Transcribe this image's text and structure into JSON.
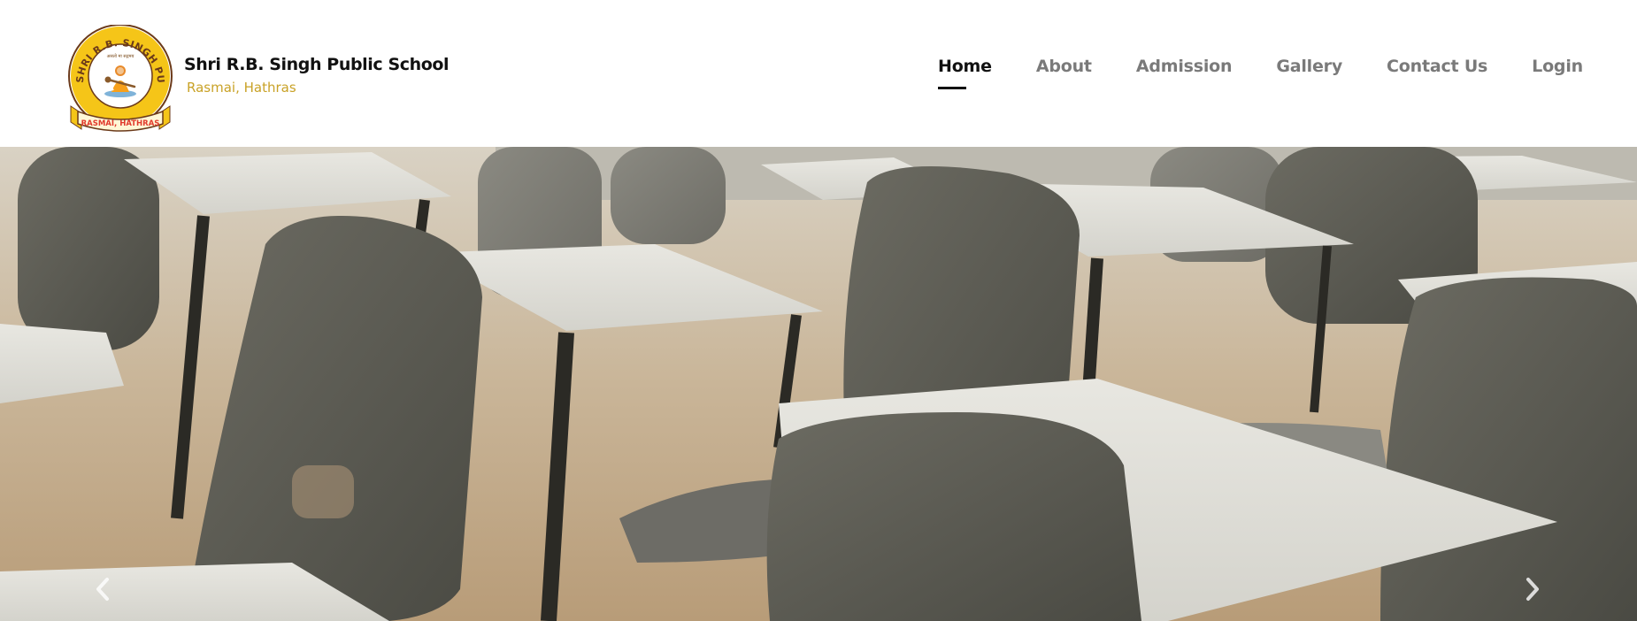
{
  "brand": {
    "name": "Shri R.B. Singh Public School",
    "location": "Rasmai, Hathras",
    "logo_ring_text": "SHRI R.B. SINGH PUBLIC SCHOOL",
    "logo_ribbon_text": "RASMAI, HATHRAS",
    "logo_motto": "असतो मा सद्गमय",
    "colors": {
      "gold": "#c9a227",
      "ribbon": "#e03a2c",
      "ring": "#d8a21d"
    }
  },
  "nav": {
    "items": [
      {
        "label": "Home",
        "active": true
      },
      {
        "label": "About",
        "active": false
      },
      {
        "label": "Admission",
        "active": false
      },
      {
        "label": "Gallery",
        "active": false
      },
      {
        "label": "Contact Us",
        "active": false
      },
      {
        "label": "Login",
        "active": false
      }
    ]
  },
  "hero": {
    "image": "classroom-desks-photo",
    "prev_icon": "chevron-left-icon",
    "next_icon": "chevron-right-icon"
  }
}
